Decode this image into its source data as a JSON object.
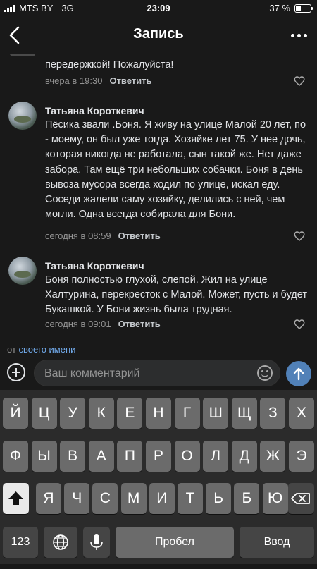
{
  "status": {
    "carrier": "MTS BY",
    "network": "3G",
    "time": "23:09",
    "battery": "37 %",
    "battery_level": 0.37
  },
  "nav": {
    "title": "Запись"
  },
  "comments": [
    {
      "name": "",
      "text": "передержкой! Пожалуйста!",
      "time": "вчера в 19:30",
      "reply": "Ответить"
    },
    {
      "name": "Татьяна Короткевич",
      "text": "Пёсика звали .Боня. Я живу на улице Малой 20 лет, по - моему, он был уже тогда. Хозяйке лет 75. У нее дочь, которая никогда не работала, сын такой же. Нет даже забора. Там ещё три небольших собачки. Боня в день вывоза мусора всегда ходил по улице, искал еду. Соседи жалели саму хозяйку, делились с ней, чем могли. Одна всегда собирала для Бони.",
      "time": "сегодня в 08:59",
      "reply": "Ответить"
    },
    {
      "name": "Татьяна Короткевич",
      "text": "Боня полностью глухой, слепой. Жил на улице Халтурина, перекресток с Малой. Может, пусть и будет Букашкой. У Бони жизнь была трудная.",
      "time": "сегодня в 09:01",
      "reply": "Ответить"
    }
  ],
  "from": {
    "prefix": "от",
    "link": "своего имени"
  },
  "composer": {
    "placeholder": "Ваш комментарий"
  },
  "keyboard": {
    "row1": [
      "Й",
      "Ц",
      "У",
      "К",
      "Е",
      "Н",
      "Г",
      "Ш",
      "Щ",
      "З",
      "Х"
    ],
    "row2": [
      "Ф",
      "Ы",
      "В",
      "А",
      "П",
      "Р",
      "О",
      "Л",
      "Д",
      "Ж",
      "Э"
    ],
    "row3": [
      "Я",
      "Ч",
      "С",
      "М",
      "И",
      "Т",
      "Ь",
      "Б",
      "Ю"
    ],
    "numbers": "123",
    "space": "Пробел",
    "enter": "Ввод"
  },
  "icons": {
    "back": "chevron-left-icon",
    "more": "more-horizontal-icon",
    "like": "heart-icon",
    "add": "plus-circle-icon",
    "emoji": "smile-icon",
    "send": "arrow-up-icon",
    "shift": "shift-icon",
    "delete": "backspace-icon",
    "globe": "globe-icon",
    "mic": "microphone-icon"
  },
  "colors": {
    "background": "#191919",
    "link": "#71aaeb",
    "send": "#5181b8"
  }
}
